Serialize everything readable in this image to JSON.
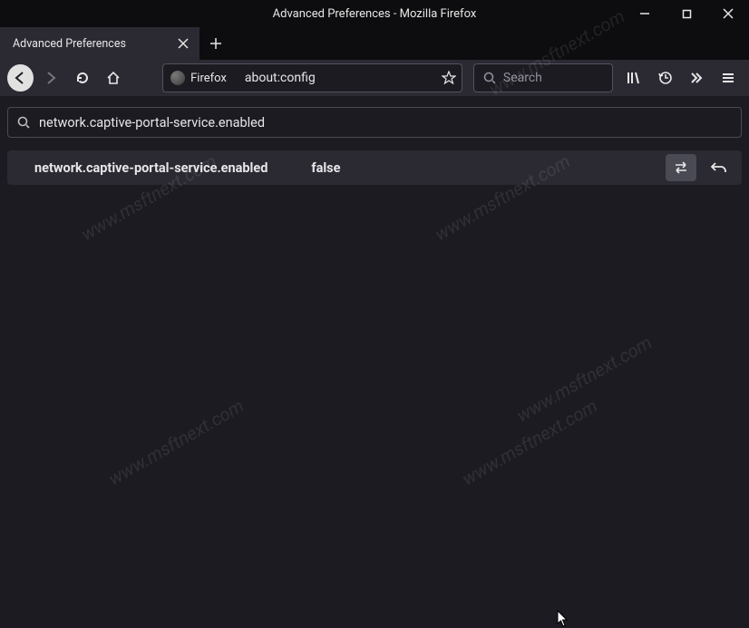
{
  "window": {
    "title": "Advanced Preferences - Mozilla Firefox"
  },
  "tabs": [
    {
      "label": "Advanced Preferences"
    }
  ],
  "toolbar": {
    "identity_label": "Firefox",
    "url": "about:config",
    "search_placeholder": "Search"
  },
  "config": {
    "search_value": "network.captive-portal-service.enabled",
    "prefs": [
      {
        "name": "network.captive-portal-service.enabled",
        "value": "false"
      }
    ]
  },
  "watermark": "www.msftnext.com"
}
